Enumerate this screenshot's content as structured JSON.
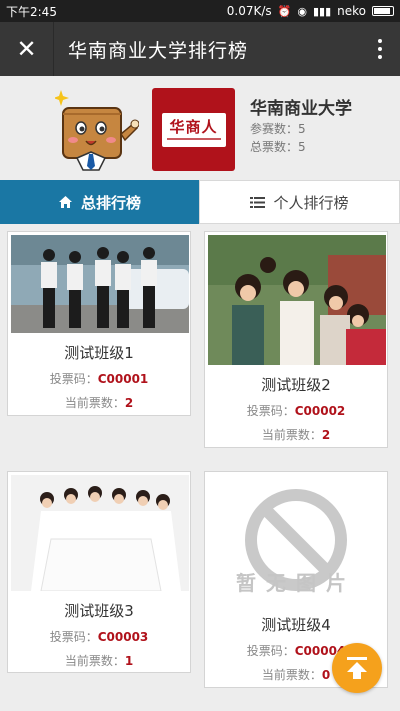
{
  "status_bar": {
    "time": "下午2:45",
    "speed": "0.07K/s",
    "carrier": "neko"
  },
  "navbar": {
    "title": "华南商业大学排行榜",
    "close_icon": "close-icon",
    "more_icon": "more-vertical-icon"
  },
  "school": {
    "name": "华南商业大学",
    "logo_text": "华商人",
    "participants_label": "参赛数：",
    "participants": "5",
    "votes_label": "总票数：",
    "votes": "5"
  },
  "tabs": [
    {
      "label": "总排行榜",
      "icon": "home-icon",
      "active": true
    },
    {
      "label": "个人排行榜",
      "icon": "list-icon",
      "active": false
    }
  ],
  "cards": [
    {
      "name": "测试班级1",
      "code_label": "投票码：",
      "code": "C00001",
      "votes_label": "当前票数：",
      "votes": "2"
    },
    {
      "name": "测试班级2",
      "code_label": "投票码：",
      "code": "C00002",
      "votes_label": "当前票数：",
      "votes": "2"
    },
    {
      "name": "测试班级3",
      "code_label": "投票码：",
      "code": "C00003",
      "votes_label": "当前票数：",
      "votes": "1"
    },
    {
      "name": "测试班级4",
      "code_label": "投票码：",
      "code": "C00004",
      "votes_label": "当前票数：",
      "votes": "0",
      "no_image_text": "暂无图片"
    }
  ],
  "colors": {
    "accent": "#1a77a4",
    "value": "#b0121b",
    "fab": "#f5a11c"
  }
}
